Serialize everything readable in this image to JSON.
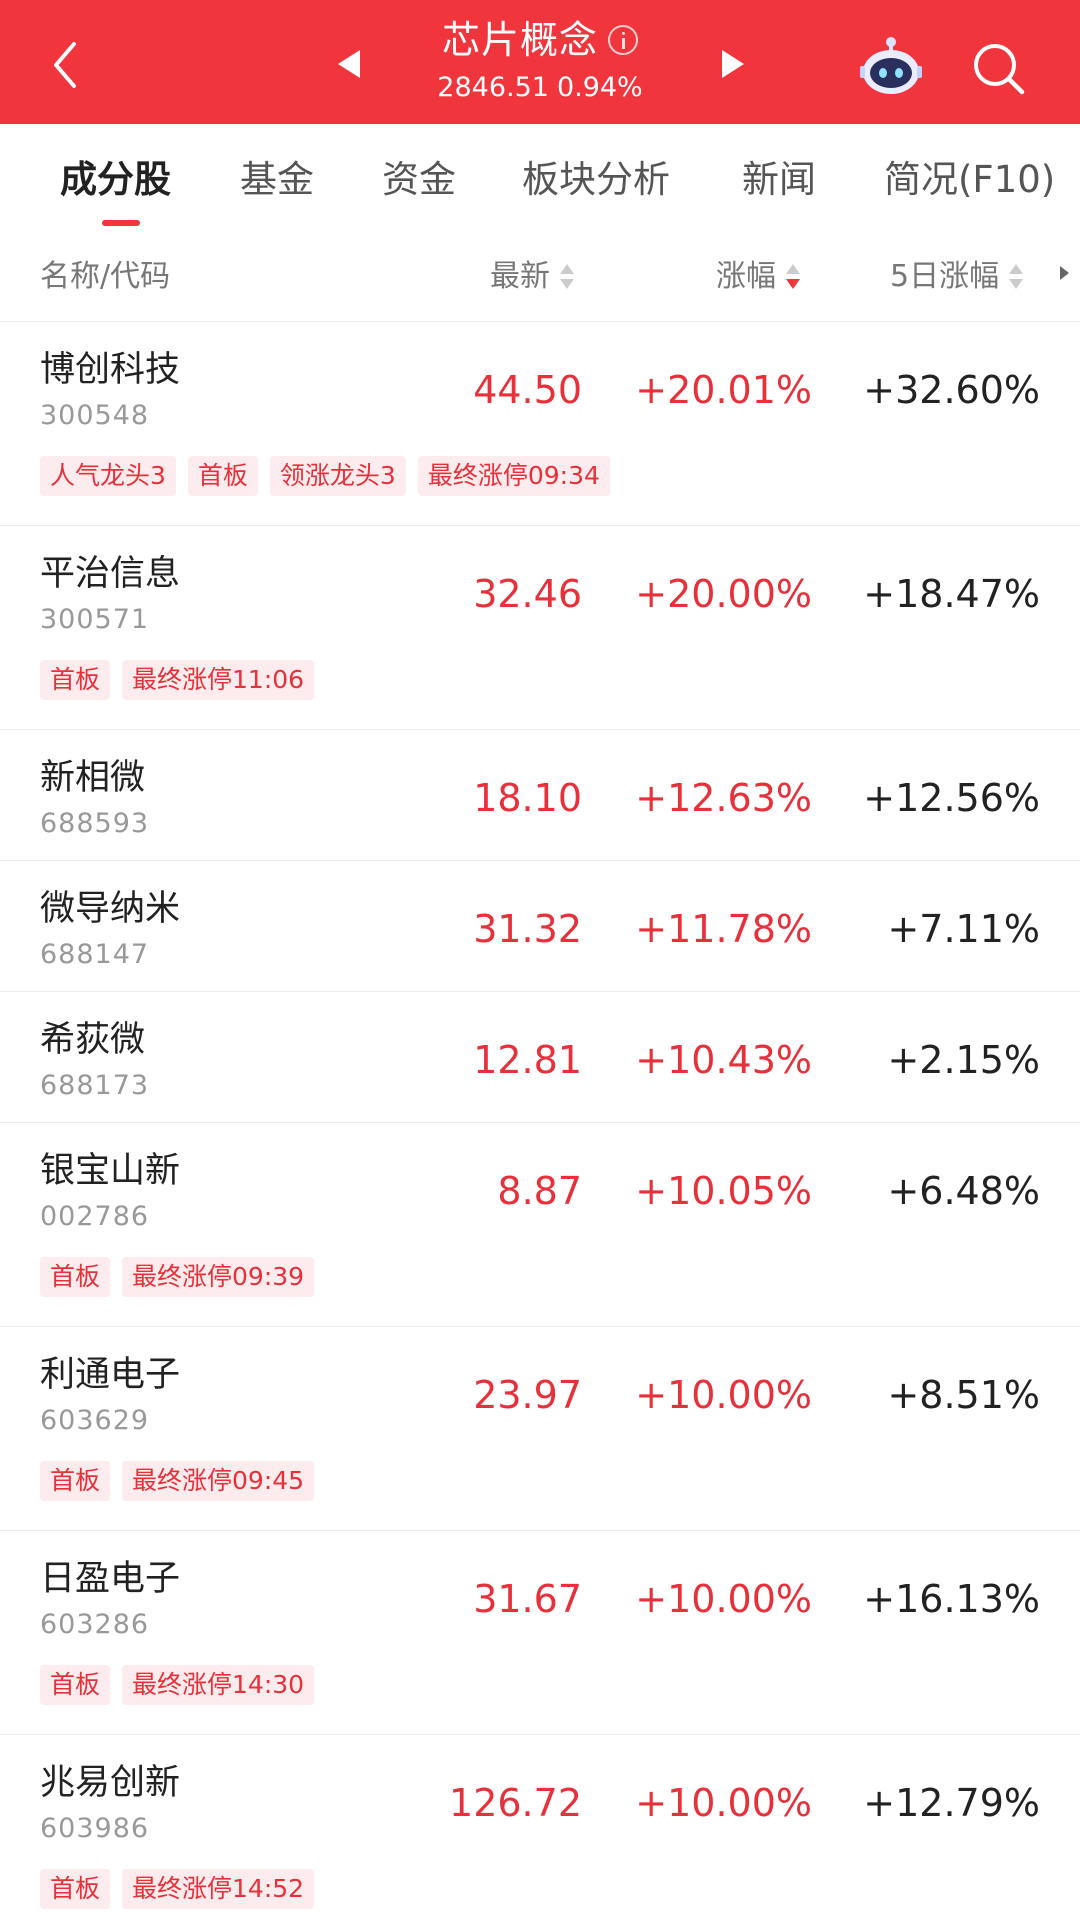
{
  "header": {
    "title": "芯片概念",
    "index_value": "2846.51",
    "index_change": "0.94%",
    "bg_color": "#f1353d"
  },
  "icons": {
    "back": "chevron-left-icon",
    "prev": "triangle-left-icon",
    "next": "triangle-right-icon",
    "info": "info-icon",
    "robot": "robot-assistant-icon",
    "search": "search-icon"
  },
  "tabs": [
    {
      "label": "成分股",
      "active": true
    },
    {
      "label": "基金"
    },
    {
      "label": "资金"
    },
    {
      "label": "板块分析"
    },
    {
      "label": "新闻"
    },
    {
      "label": "简况(F10)"
    }
  ],
  "columns": {
    "name": "名称/代码",
    "price": "最新",
    "change": "涨幅",
    "change5d": "5日涨幅",
    "sorted_by": "change",
    "sort_order": "desc"
  },
  "stocks": [
    {
      "name": "博创科技",
      "code": "300548",
      "price": "44.50",
      "change": "+20.01%",
      "change5d": "+32.60%",
      "tags": [
        "人气龙头3",
        "首板",
        "领涨龙头3",
        "最终涨停09:34"
      ]
    },
    {
      "name": "平治信息",
      "code": "300571",
      "price": "32.46",
      "change": "+20.00%",
      "change5d": "+18.47%",
      "tags": [
        "首板",
        "最终涨停11:06"
      ]
    },
    {
      "name": "新相微",
      "code": "688593",
      "price": "18.10",
      "change": "+12.63%",
      "change5d": "+12.56%",
      "tags": []
    },
    {
      "name": "微导纳米",
      "code": "688147",
      "price": "31.32",
      "change": "+11.78%",
      "change5d": "+7.11%",
      "tags": []
    },
    {
      "name": "希荻微",
      "code": "688173",
      "price": "12.81",
      "change": "+10.43%",
      "change5d": "+2.15%",
      "tags": []
    },
    {
      "name": "银宝山新",
      "code": "002786",
      "price": "8.87",
      "change": "+10.05%",
      "change5d": "+6.48%",
      "tags": [
        "首板",
        "最终涨停09:39"
      ]
    },
    {
      "name": "利通电子",
      "code": "603629",
      "price": "23.97",
      "change": "+10.00%",
      "change5d": "+8.51%",
      "tags": [
        "首板",
        "最终涨停09:45"
      ]
    },
    {
      "name": "日盈电子",
      "code": "603286",
      "price": "31.67",
      "change": "+10.00%",
      "change5d": "+16.13%",
      "tags": [
        "首板",
        "最终涨停14:30"
      ]
    },
    {
      "name": "兆易创新",
      "code": "603986",
      "price": "126.72",
      "change": "+10.00%",
      "change5d": "+12.79%",
      "tags": [
        "首板",
        "最终涨停14:52"
      ]
    }
  ],
  "colors": {
    "accent": "#f1353d",
    "up": "#e8303a",
    "tag_bg": "#fdeced"
  }
}
